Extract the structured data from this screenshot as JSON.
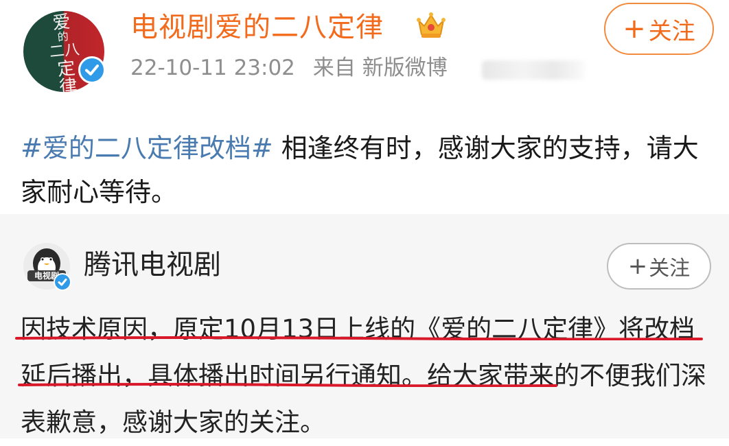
{
  "post": {
    "author": "电视剧爱的二八定律",
    "author_avatar_text": [
      "爱",
      "的",
      "二八",
      "定",
      "律"
    ],
    "verified_icon": "verified-badge-icon",
    "vip_icon": "crown-icon",
    "timestamp": "22-10-11 23:02",
    "source": "来自 新版微博",
    "follow_label": "关注",
    "hashtag": "#爱的二八定律改档#",
    "text": " 相逢终有时，感谢大家的支持，请大家耐心等待。"
  },
  "repost": {
    "author": "腾讯电视剧",
    "avatar_text": "电视剧",
    "follow_label": "关注",
    "text_part1": "因技术原因，原定10月13日上线的《爱的二八定律》将改档延后播出，具体播出时间另行通知。",
    "text_part2": "给大家带来的不便我们深表歉意，感谢大家的关注。"
  },
  "colors": {
    "author_orange": "#f26a1b",
    "hashtag_blue": "#4a7bb0",
    "verify_blue": "#2f9ae8",
    "underline_red": "#d9182a",
    "repost_bg": "#f6f6f6"
  }
}
